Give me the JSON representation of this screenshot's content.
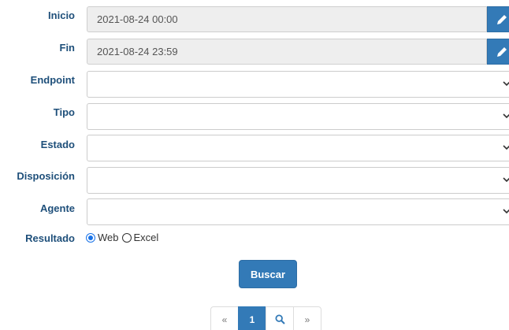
{
  "form": {
    "inicio": {
      "label": "Inicio",
      "value": "2021-08-24 00:00"
    },
    "fin": {
      "label": "Fin",
      "value": "2021-08-24 23:59"
    },
    "endpoint": {
      "label": "Endpoint",
      "value": ""
    },
    "tipo": {
      "label": "Tipo",
      "value": ""
    },
    "estado": {
      "label": "Estado",
      "value": ""
    },
    "disposicion": {
      "label": "Disposición",
      "value": ""
    },
    "agente": {
      "label": "Agente",
      "value": ""
    },
    "resultado": {
      "label": "Resultado",
      "options": [
        {
          "label": "Web",
          "checked": true
        },
        {
          "label": "Excel",
          "checked": false
        }
      ]
    },
    "search_button": "Buscar"
  },
  "pagination": {
    "prev": "«",
    "current": "1",
    "next": "»"
  },
  "icons": {
    "edit": "pencil-icon",
    "select_caret": "chevron-down-icon",
    "search": "search-icon"
  },
  "colors": {
    "primary": "#337ab7",
    "label": "#1e4f7a",
    "readonly_bg": "#eeeeee"
  }
}
